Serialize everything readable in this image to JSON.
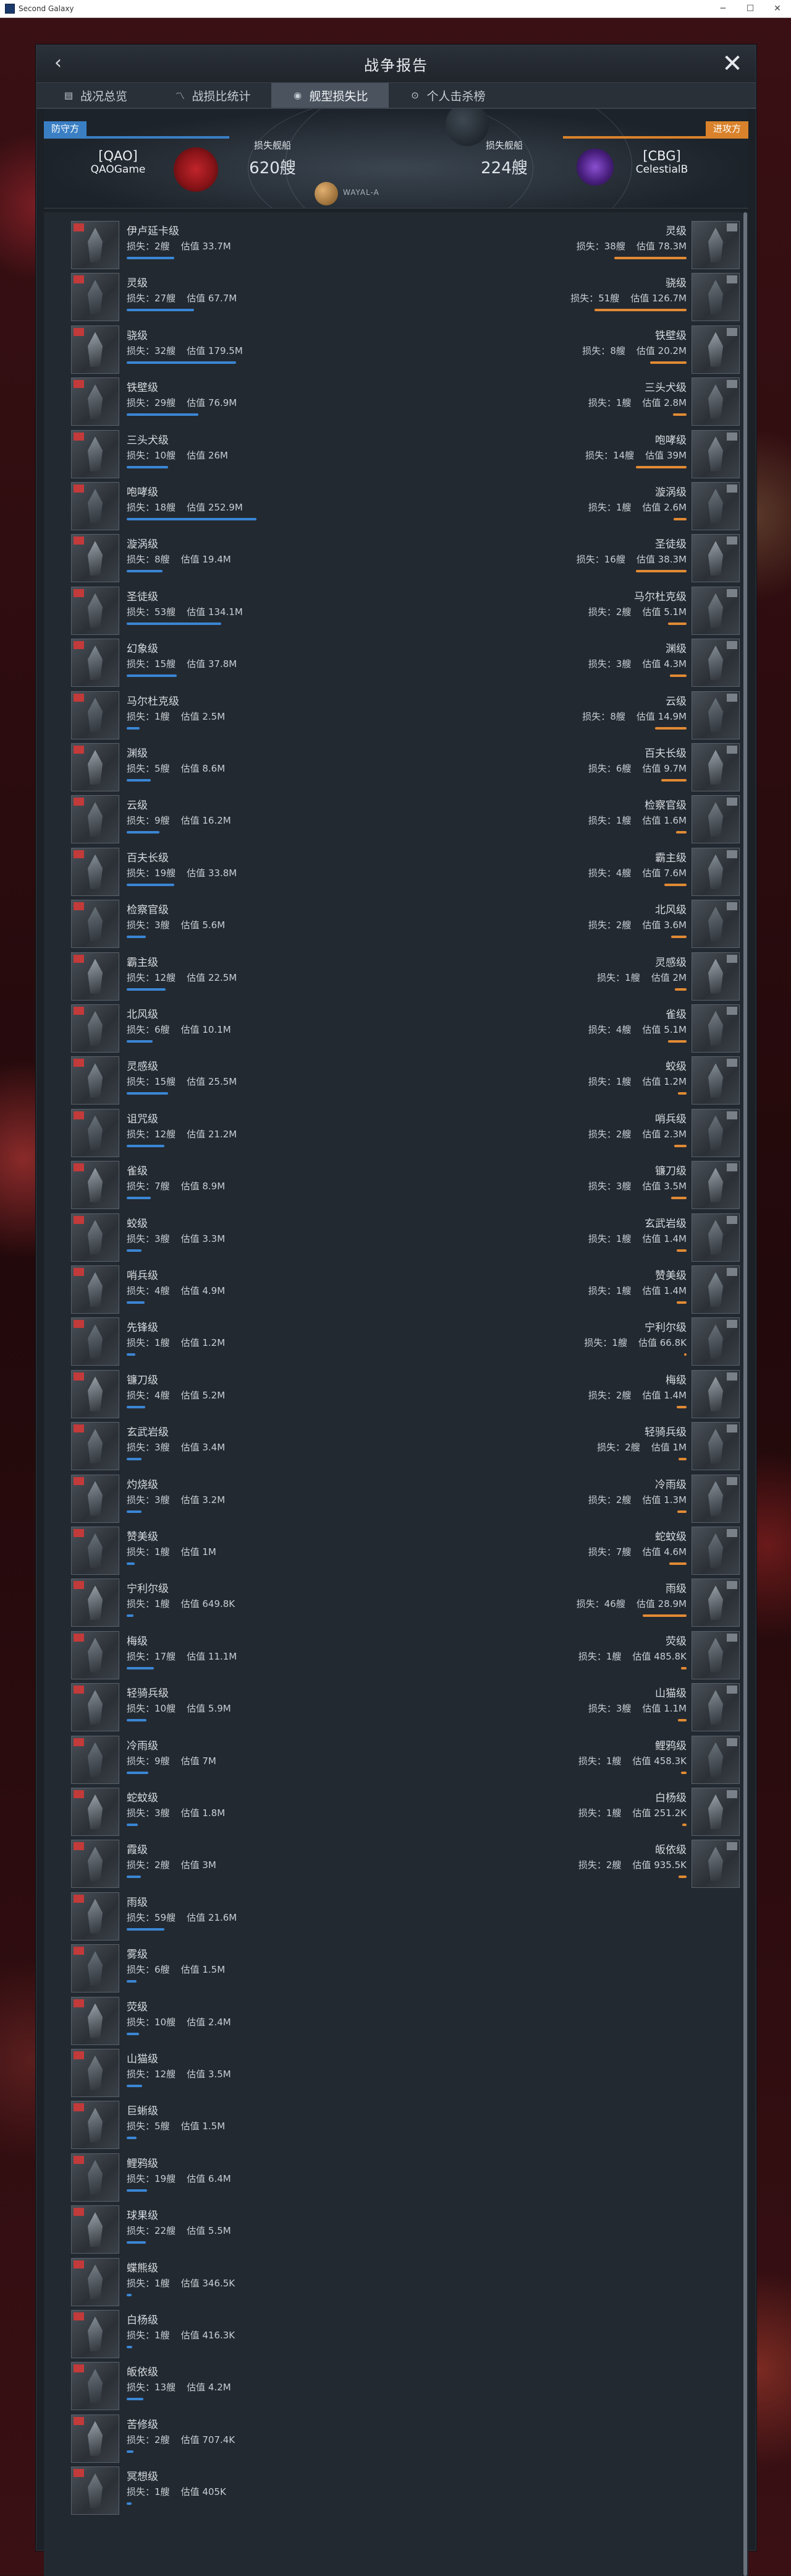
{
  "window": {
    "title": "Second Galaxy"
  },
  "panel": {
    "title": "战争报告"
  },
  "tabs": [
    {
      "label": "战况总览"
    },
    {
      "label": "战损比统计"
    },
    {
      "label": "舰型损失比"
    },
    {
      "label": "个人击杀榜"
    }
  ],
  "header": {
    "planet": "WAYAL-A",
    "defender": {
      "side_label": "防守方",
      "ticker": "[QAO]",
      "name": "QAOGame",
      "loss_label": "损失舰船",
      "loss_value": "620艘"
    },
    "attacker": {
      "side_label": "进攻方",
      "ticker": "[CBG]",
      "name": "CelestialB",
      "loss_label": "损失舰船",
      "loss_value": "224艘"
    }
  },
  "labels": {
    "loss_prefix": "损失：",
    "value_prefix": "估值"
  },
  "colors": {
    "defender": "#3a86d4",
    "attacker": "#e18a34"
  },
  "defender_ships": [
    {
      "name": "伊卢延卡级",
      "loss": "2艘",
      "value": "33.7M",
      "value_num": 33.7
    },
    {
      "name": "灵级",
      "loss": "27艘",
      "value": "67.7M",
      "value_num": 67.7
    },
    {
      "name": "骁级",
      "loss": "32艘",
      "value": "179.5M",
      "value_num": 179.5
    },
    {
      "name": "铁壁级",
      "loss": "29艘",
      "value": "76.9M",
      "value_num": 76.9
    },
    {
      "name": "三头犬级",
      "loss": "10艘",
      "value": "26M",
      "value_num": 26
    },
    {
      "name": "咆哮级",
      "loss": "18艘",
      "value": "252.9M",
      "value_num": 252.9
    },
    {
      "name": "漩涡级",
      "loss": "8艘",
      "value": "19.4M",
      "value_num": 19.4
    },
    {
      "name": "圣徒级",
      "loss": "53艘",
      "value": "134.1M",
      "value_num": 134.1
    },
    {
      "name": "幻象级",
      "loss": "15艘",
      "value": "37.8M",
      "value_num": 37.8
    },
    {
      "name": "马尔杜克级",
      "loss": "1艘",
      "value": "2.5M",
      "value_num": 2.5
    },
    {
      "name": "渊级",
      "loss": "5艘",
      "value": "8.6M",
      "value_num": 8.6
    },
    {
      "name": "云级",
      "loss": "9艘",
      "value": "16.2M",
      "value_num": 16.2
    },
    {
      "name": "百夫长级",
      "loss": "19艘",
      "value": "33.8M",
      "value_num": 33.8
    },
    {
      "name": "检察官级",
      "loss": "3艘",
      "value": "5.6M",
      "value_num": 5.6
    },
    {
      "name": "霸主级",
      "loss": "12艘",
      "value": "22.5M",
      "value_num": 22.5
    },
    {
      "name": "北风级",
      "loss": "6艘",
      "value": "10.1M",
      "value_num": 10.1
    },
    {
      "name": "灵感级",
      "loss": "15艘",
      "value": "25.5M",
      "value_num": 25.5
    },
    {
      "name": "诅咒级",
      "loss": "12艘",
      "value": "21.2M",
      "value_num": 21.2
    },
    {
      "name": "雀级",
      "loss": "7艘",
      "value": "8.9M",
      "value_num": 8.9
    },
    {
      "name": "蛟级",
      "loss": "3艘",
      "value": "3.3M",
      "value_num": 3.3
    },
    {
      "name": "哨兵级",
      "loss": "4艘",
      "value": "4.9M",
      "value_num": 4.9
    },
    {
      "name": "先锋级",
      "loss": "1艘",
      "value": "1.2M",
      "value_num": 1.2
    },
    {
      "name": "镰刀级",
      "loss": "4艘",
      "value": "5.2M",
      "value_num": 5.2
    },
    {
      "name": "玄武岩级",
      "loss": "3艘",
      "value": "3.4M",
      "value_num": 3.4
    },
    {
      "name": "灼烧级",
      "loss": "3艘",
      "value": "3.2M",
      "value_num": 3.2
    },
    {
      "name": "赞美级",
      "loss": "1艘",
      "value": "1M",
      "value_num": 1
    },
    {
      "name": "宁利尔级",
      "loss": "1艘",
      "value": "649.8K",
      "value_num": 0.6498
    },
    {
      "name": "梅级",
      "loss": "17艘",
      "value": "11.1M",
      "value_num": 11.1
    },
    {
      "name": "轻骑兵级",
      "loss": "10艘",
      "value": "5.9M",
      "value_num": 5.9
    },
    {
      "name": "冷雨级",
      "loss": "9艘",
      "value": "7M",
      "value_num": 7
    },
    {
      "name": "蛇蚊级",
      "loss": "3艘",
      "value": "1.8M",
      "value_num": 1.8
    },
    {
      "name": "霞级",
      "loss": "2艘",
      "value": "3M",
      "value_num": 3
    },
    {
      "name": "雨级",
      "loss": "59艘",
      "value": "21.6M",
      "value_num": 21.6
    },
    {
      "name": "雾级",
      "loss": "6艘",
      "value": "1.5M",
      "value_num": 1.5
    },
    {
      "name": "荧级",
      "loss": "10艘",
      "value": "2.4M",
      "value_num": 2.4
    },
    {
      "name": "山猫级",
      "loss": "12艘",
      "value": "3.5M",
      "value_num": 3.5
    },
    {
      "name": "巨蜥级",
      "loss": "5艘",
      "value": "1.5M",
      "value_num": 1.5
    },
    {
      "name": "鲤鸦级",
      "loss": "19艘",
      "value": "6.4M",
      "value_num": 6.4
    },
    {
      "name": "球果级",
      "loss": "22艘",
      "value": "5.5M",
      "value_num": 5.5
    },
    {
      "name": "蝶熊级",
      "loss": "1艘",
      "value": "346.5K",
      "value_num": 0.3465
    },
    {
      "name": "白杨级",
      "loss": "1艘",
      "value": "416.3K",
      "value_num": 0.4163
    },
    {
      "name": "皈依级",
      "loss": "13艘",
      "value": "4.2M",
      "value_num": 4.2
    },
    {
      "name": "苦修级",
      "loss": "2艘",
      "value": "707.4K",
      "value_num": 0.7074
    },
    {
      "name": "冥想级",
      "loss": "1艘",
      "value": "405K",
      "value_num": 0.405
    }
  ],
  "attacker_ships": [
    {
      "name": "灵级",
      "loss": "38艘",
      "value": "78.3M",
      "value_num": 78.3
    },
    {
      "name": "骁级",
      "loss": "51艘",
      "value": "126.7M",
      "value_num": 126.7
    },
    {
      "name": "铁壁级",
      "loss": "8艘",
      "value": "20.2M",
      "value_num": 20.2
    },
    {
      "name": "三头犬级",
      "loss": "1艘",
      "value": "2.8M",
      "value_num": 2.8
    },
    {
      "name": "咆哮级",
      "loss": "14艘",
      "value": "39M",
      "value_num": 39
    },
    {
      "name": "漩涡级",
      "loss": "1艘",
      "value": "2.6M",
      "value_num": 2.6
    },
    {
      "name": "圣徒级",
      "loss": "16艘",
      "value": "38.3M",
      "value_num": 38.3
    },
    {
      "name": "马尔杜克级",
      "loss": "2艘",
      "value": "5.1M",
      "value_num": 5.1
    },
    {
      "name": "渊级",
      "loss": "3艘",
      "value": "4.3M",
      "value_num": 4.3
    },
    {
      "name": "云级",
      "loss": "8艘",
      "value": "14.9M",
      "value_num": 14.9
    },
    {
      "name": "百夫长级",
      "loss": "6艘",
      "value": "9.7M",
      "value_num": 9.7
    },
    {
      "name": "检察官级",
      "loss": "1艘",
      "value": "1.6M",
      "value_num": 1.6
    },
    {
      "name": "霸主级",
      "loss": "4艘",
      "value": "7.6M",
      "value_num": 7.6
    },
    {
      "name": "北风级",
      "loss": "2艘",
      "value": "3.6M",
      "value_num": 3.6
    },
    {
      "name": "灵感级",
      "loss": "1艘",
      "value": "2M",
      "value_num": 2
    },
    {
      "name": "雀级",
      "loss": "4艘",
      "value": "5.1M",
      "value_num": 5.1
    },
    {
      "name": "蛟级",
      "loss": "1艘",
      "value": "1.2M",
      "value_num": 1.2
    },
    {
      "name": "哨兵级",
      "loss": "2艘",
      "value": "2.3M",
      "value_num": 2.3
    },
    {
      "name": "镰刀级",
      "loss": "3艘",
      "value": "3.5M",
      "value_num": 3.5
    },
    {
      "name": "玄武岩级",
      "loss": "1艘",
      "value": "1.4M",
      "value_num": 1.4
    },
    {
      "name": "赞美级",
      "loss": "1艘",
      "value": "1.4M",
      "value_num": 1.4
    },
    {
      "name": "宁利尔级",
      "loss": "1艘",
      "value": "66.8K",
      "value_num": 0.0668
    },
    {
      "name": "梅级",
      "loss": "2艘",
      "value": "1.4M",
      "value_num": 1.4
    },
    {
      "name": "轻骑兵级",
      "loss": "2艘",
      "value": "1M",
      "value_num": 1
    },
    {
      "name": "冷雨级",
      "loss": "2艘",
      "value": "1.3M",
      "value_num": 1.3
    },
    {
      "name": "蛇蚊级",
      "loss": "7艘",
      "value": "4.6M",
      "value_num": 4.6
    },
    {
      "name": "雨级",
      "loss": "46艘",
      "value": "28.9M",
      "value_num": 28.9
    },
    {
      "name": "荧级",
      "loss": "1艘",
      "value": "485.8K",
      "value_num": 0.4858
    },
    {
      "name": "山猫级",
      "loss": "3艘",
      "value": "1.1M",
      "value_num": 1.1
    },
    {
      "name": "鲤鸦级",
      "loss": "1艘",
      "value": "458.3K",
      "value_num": 0.4583
    },
    {
      "name": "白杨级",
      "loss": "1艘",
      "value": "251.2K",
      "value_num": 0.2512
    },
    {
      "name": "皈依级",
      "loss": "2艘",
      "value": "935.5K",
      "value_num": 0.9355
    }
  ]
}
